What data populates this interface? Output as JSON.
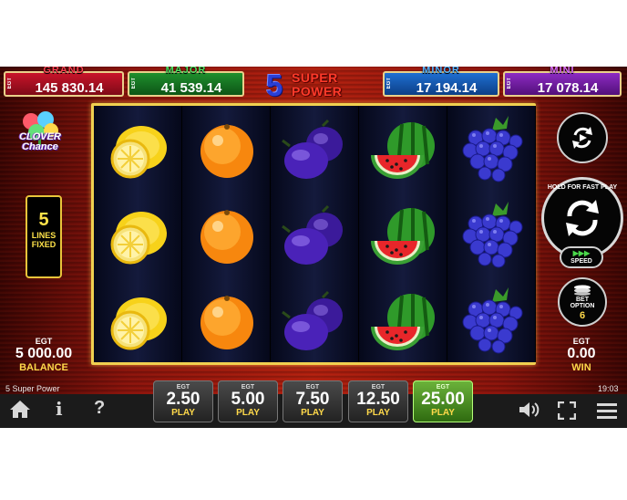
{
  "jackpots": {
    "brand": "EGT",
    "grand": {
      "name": "GRAND",
      "value": "145 830.14"
    },
    "major": {
      "name": "MAJOR",
      "value": "41 539.14"
    },
    "minor": {
      "name": "MINOR",
      "value": "17 194.14"
    },
    "mini": {
      "name": "MINI",
      "value": "17 078.14"
    }
  },
  "logo": {
    "number": "5",
    "line1": "SUPER",
    "line2": "POWER"
  },
  "clover": {
    "line1": "CLOVER",
    "line2": "Chance"
  },
  "lines": {
    "count": "5",
    "label1": "LINES",
    "label2": "FIXED"
  },
  "balance": {
    "brand": "EGT",
    "value": "5 000.00",
    "label": "BALANCE"
  },
  "win": {
    "brand": "EGT",
    "value": "0.00",
    "label": "WIN"
  },
  "reels": [
    [
      "lemon-icon",
      "lemon-icon",
      "lemon-icon"
    ],
    [
      "orange-icon",
      "orange-icon",
      "orange-icon"
    ],
    [
      "plum-icon",
      "plum-icon",
      "plum-icon"
    ],
    [
      "watermelon-icon",
      "watermelon-icon",
      "watermelon-icon"
    ],
    [
      "grapes-icon",
      "grapes-icon",
      "grapes-icon"
    ]
  ],
  "controls": {
    "spin_label": "HOLD FOR FAST PLAY",
    "speed_label": "SPEED",
    "bet_option_label1": "BET",
    "bet_option_label2": "OPTION",
    "bet_option_value": "6"
  },
  "bets": [
    {
      "brand": "EGT",
      "amount": "2.50",
      "label": "PLAY",
      "active": false
    },
    {
      "brand": "EGT",
      "amount": "5.00",
      "label": "PLAY",
      "active": false
    },
    {
      "brand": "EGT",
      "amount": "7.50",
      "label": "PLAY",
      "active": false
    },
    {
      "brand": "EGT",
      "amount": "12.50",
      "label": "PLAY",
      "active": false
    },
    {
      "brand": "EGT",
      "amount": "25.00",
      "label": "PLAY",
      "active": true
    }
  ],
  "footer": {
    "game_title": "5 Super Power",
    "clock": "19:03",
    "info_glyph": "i",
    "help_glyph": "?"
  },
  "colors": {
    "accent_gold": "#f0d050",
    "active_bet": "#4f9a25",
    "play_label": "#ffd94a"
  }
}
